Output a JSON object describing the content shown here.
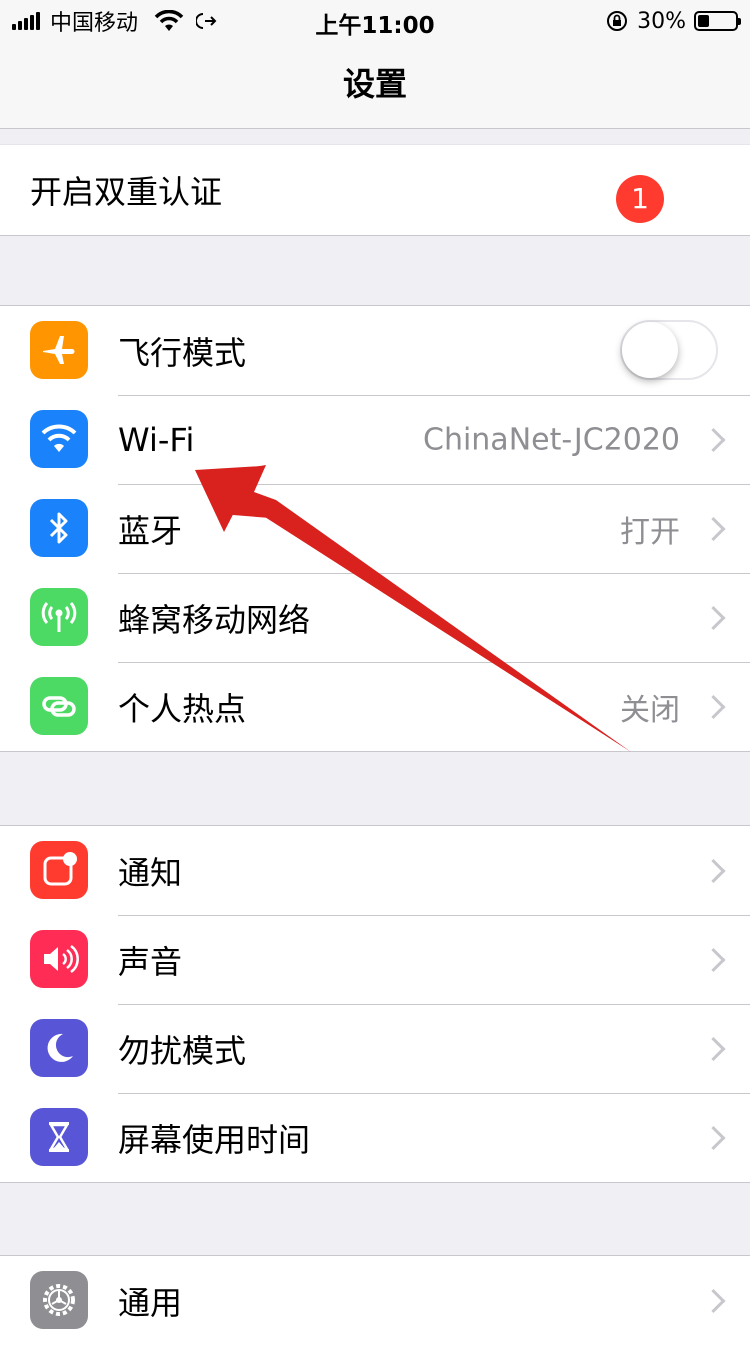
{
  "status_bar": {
    "carrier": "中国移动",
    "time": "上午11:00",
    "battery": "30%",
    "battery_level": 0.3,
    "icons": [
      "signal-icon",
      "wifi-icon",
      "location-icon",
      "rotation-lock-icon",
      "battery-icon"
    ]
  },
  "navbar": {
    "title": "设置"
  },
  "promo": {
    "label": "开启双重认证",
    "badge": "1"
  },
  "network": [
    {
      "label": "飞行模式",
      "icon": "airplane-icon",
      "color": "#ff9500",
      "toggle": false
    },
    {
      "label": "Wi-Fi",
      "icon": "wifi-icon",
      "color": "#1a82fb",
      "value": "ChinaNet-JC2020"
    },
    {
      "label": "蓝牙",
      "icon": "bluetooth-icon",
      "color": "#1a82fb",
      "value": "打开"
    },
    {
      "label": "蜂窝移动网络",
      "icon": "cellular-icon",
      "color": "#4cd964",
      "value": ""
    },
    {
      "label": "个人热点",
      "icon": "hotspot-icon",
      "color": "#4cd964",
      "value": "关闭"
    }
  ],
  "notifications": [
    {
      "label": "通知",
      "icon": "notifications-icon",
      "color": "#ff3b30"
    },
    {
      "label": "声音",
      "icon": "sound-icon",
      "color": "#ff2d55"
    },
    {
      "label": "勿扰模式",
      "icon": "moon-icon",
      "color": "#5856d6"
    },
    {
      "label": "屏幕使用时间",
      "icon": "hourglass-icon",
      "color": "#5856d6"
    }
  ],
  "general": [
    {
      "label": "通用",
      "icon": "gear-icon",
      "color": "#8e8e93"
    }
  ],
  "annotation": {
    "type": "red-arrow",
    "color": "#d9211e",
    "points_to": "Wi-Fi"
  }
}
